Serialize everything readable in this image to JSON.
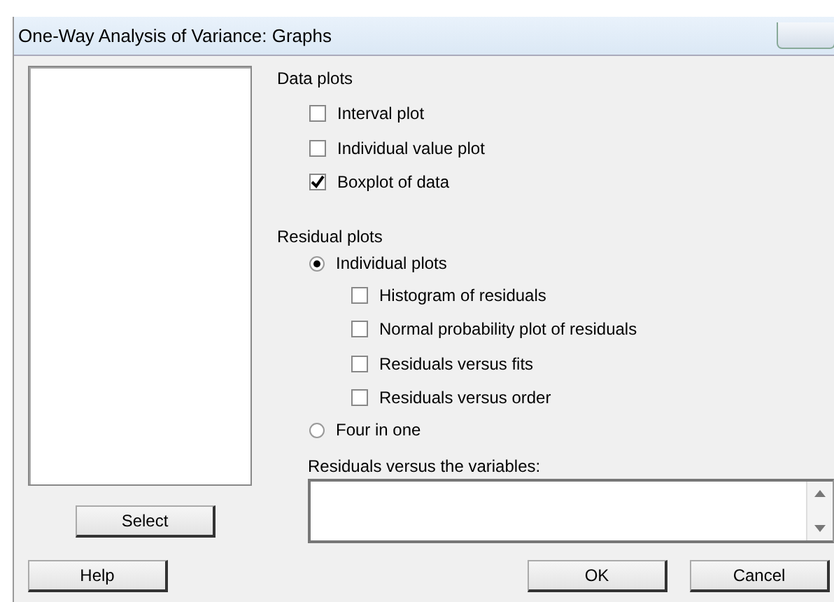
{
  "window": {
    "title": "One-Way Analysis of Variance: Graphs"
  },
  "data_plots": {
    "label": "Data plots",
    "items": [
      {
        "label": "Interval plot",
        "checked": false
      },
      {
        "label": "Individual value plot",
        "checked": false
      },
      {
        "label": "Boxplot of data",
        "checked": true
      }
    ]
  },
  "residual_plots": {
    "label": "Residual plots",
    "options": [
      {
        "label": "Individual plots",
        "selected": true,
        "items": [
          {
            "label": "Histogram of residuals",
            "checked": false
          },
          {
            "label": "Normal probability plot of residuals",
            "checked": false
          },
          {
            "label": "Residuals versus fits",
            "checked": false
          },
          {
            "label": "Residuals versus order",
            "checked": false
          }
        ]
      },
      {
        "label": "Four in one",
        "selected": false
      }
    ]
  },
  "variables_field": {
    "label": "Residuals versus the variables:"
  },
  "select_button": "Select",
  "buttons": [
    {
      "label": "Help",
      "kind": "left"
    },
    {
      "label": "OK",
      "kind": "right"
    },
    {
      "label": "Cancel",
      "kind": "right"
    }
  ]
}
